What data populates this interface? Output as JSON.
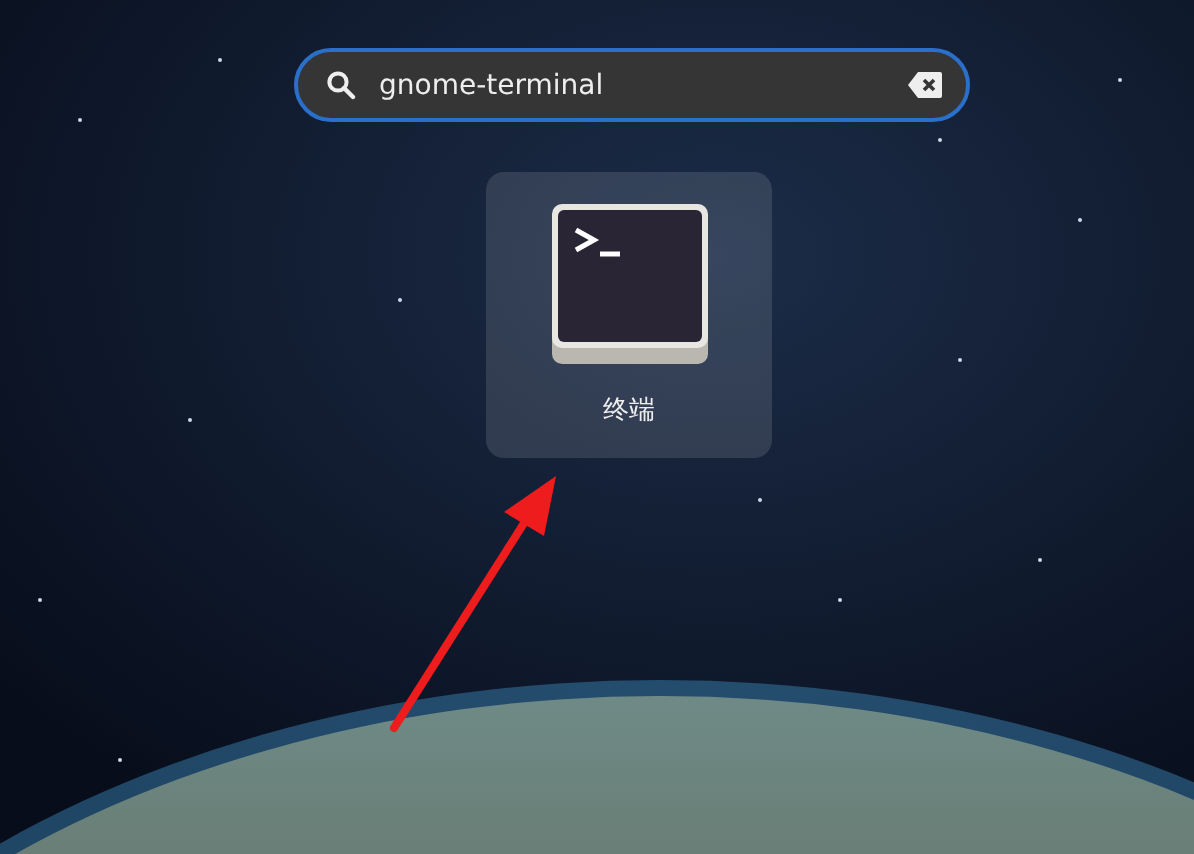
{
  "search": {
    "value": "gnome-terminal",
    "focused": true
  },
  "results": [
    {
      "label": "终端",
      "selected": true
    }
  ]
}
